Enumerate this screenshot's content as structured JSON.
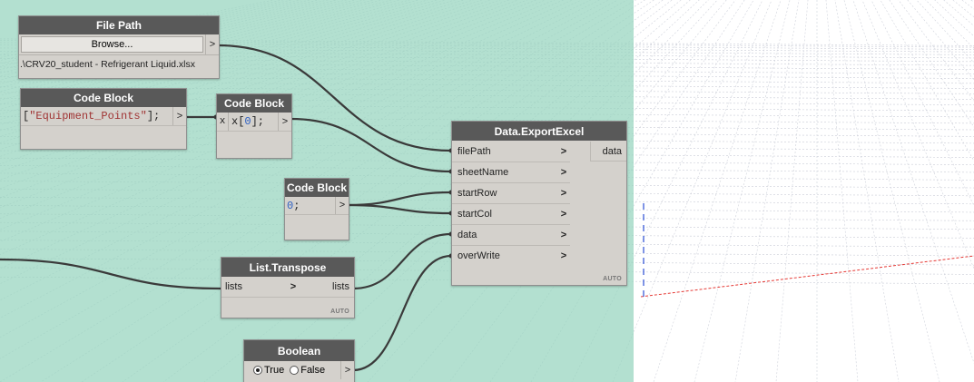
{
  "colors": {
    "group_background": "#96d4be",
    "node_header": "#595959",
    "node_body": "#d4d1cc",
    "wire": "#3a3a3a",
    "axis_red": "#e53935",
    "axis_blue": "#2c4fd6"
  },
  "nodes": {
    "file_path": {
      "title": "File Path",
      "browse_label": "Browse...",
      "output_arrow": ">",
      "path_value": ".\\CRV20_student - Refrigerant Liquid.xlsx"
    },
    "code_block_sheet": {
      "title": "Code Block",
      "code_string": "\"Equipment_Points\"",
      "code_open": "[",
      "code_close": "];",
      "output_arrow": ">"
    },
    "code_block_index": {
      "title": "Code Block",
      "input_label": "x",
      "code_prefix": "x[",
      "code_number": "0",
      "code_suffix": "];",
      "output_arrow": ">"
    },
    "code_block_zero": {
      "title": "Code Block",
      "code_number": "0",
      "code_suffix": ";",
      "output_arrow": ">"
    },
    "export_excel": {
      "title": "Data.ExportExcel",
      "inputs": [
        {
          "label": "filePath",
          "arrow": ">"
        },
        {
          "label": "sheetName",
          "arrow": ">"
        },
        {
          "label": "startRow",
          "arrow": ">"
        },
        {
          "label": "startCol",
          "arrow": ">"
        },
        {
          "label": "data",
          "arrow": ">"
        },
        {
          "label": "overWrite",
          "arrow": ">"
        }
      ],
      "output_label": "data",
      "lacing": "AUTO"
    },
    "list_transpose": {
      "title": "List.Transpose",
      "input_label": "lists",
      "input_arrow": ">",
      "output_label": "lists",
      "lacing": "AUTO"
    },
    "boolean": {
      "title": "Boolean",
      "true_label": "True",
      "false_label": "False",
      "selected": "True",
      "output_arrow": ">"
    }
  }
}
